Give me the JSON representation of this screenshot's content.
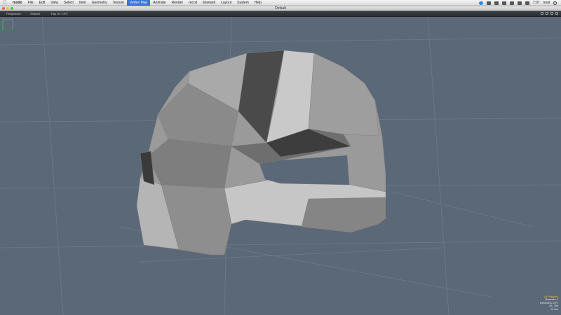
{
  "menubar": {
    "apple_icon": "apple-icon",
    "app_name": "modo",
    "items": [
      "File",
      "Edit",
      "View",
      "Select",
      "Item",
      "Geometry",
      "Texture",
      "Vertex Map",
      "Animate",
      "Render",
      "recoil",
      "Maxwell",
      "Layout",
      "System",
      "Help"
    ],
    "active_index": 7,
    "clock": "7:07",
    "user": "neal"
  },
  "window": {
    "title": "Default"
  },
  "viewport_header": {
    "view_mode": "Perspective",
    "shading": "Shaded",
    "ray_gl": "Ray GL: OFF"
  },
  "info": {
    "mode": "All Polygons",
    "channels": "Channels: 0",
    "deformers": "Deformers: OFF",
    "gl_polys": "GL: 306",
    "size": "10 mm"
  },
  "colors": {
    "viewport_bg": "#5b6878",
    "accent": "#3b73d4",
    "info_highlight": "#f0c030"
  }
}
